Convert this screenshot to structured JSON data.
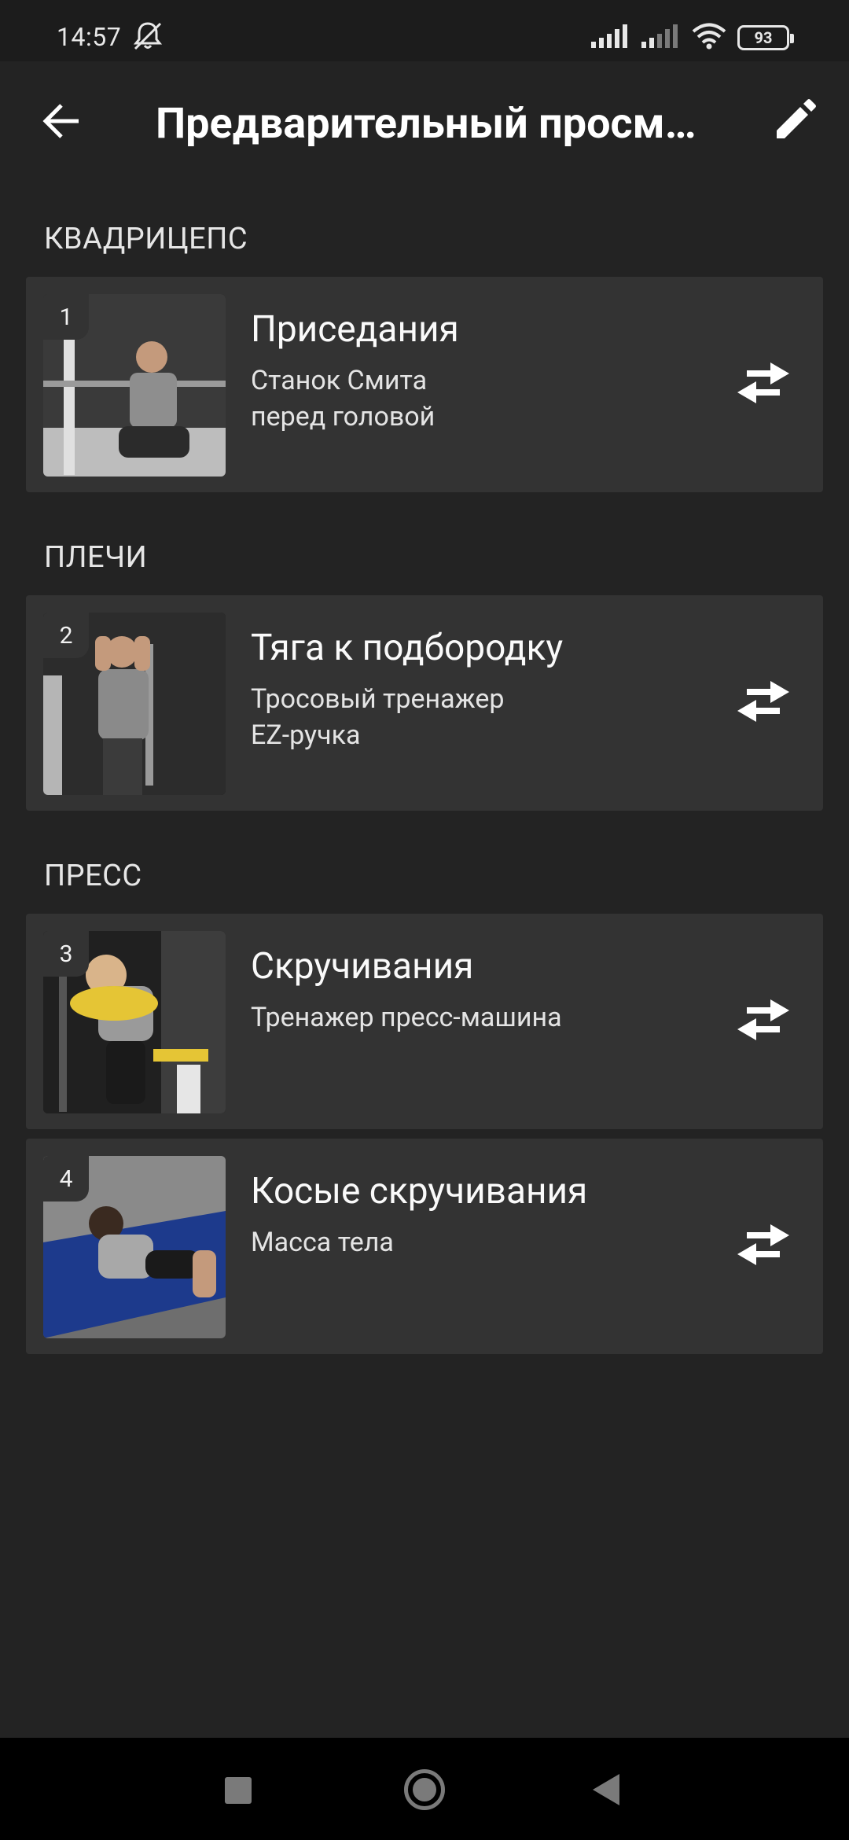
{
  "status_bar": {
    "time": "14:57",
    "battery": "93"
  },
  "app_bar": {
    "title": "Предварительный просм…",
    "back_icon": "arrow-back-icon",
    "edit_icon": "pencil-icon"
  },
  "sections": [
    {
      "header": "КВАДРИЦЕПС",
      "exercises": [
        {
          "number": "1",
          "title": "Приседания",
          "sub1": "Станок Смита",
          "sub2": "перед головой"
        }
      ]
    },
    {
      "header": "ПЛЕЧИ",
      "exercises": [
        {
          "number": "2",
          "title": "Тяга к подбородку",
          "sub1": "Тросовый тренажер",
          "sub2": "EZ-ручка"
        }
      ]
    },
    {
      "header": "ПРЕСС",
      "exercises": [
        {
          "number": "3",
          "title": "Скручивания",
          "sub1": "Тренажер пресс-машина"
        },
        {
          "number": "4",
          "title": "Косые скручивания",
          "sub1": "Масса тела"
        }
      ]
    }
  ],
  "colors": {
    "background": "#232323",
    "card": "#333333",
    "status_bar": "#1c1c1c",
    "nav_bar": "#000000"
  }
}
